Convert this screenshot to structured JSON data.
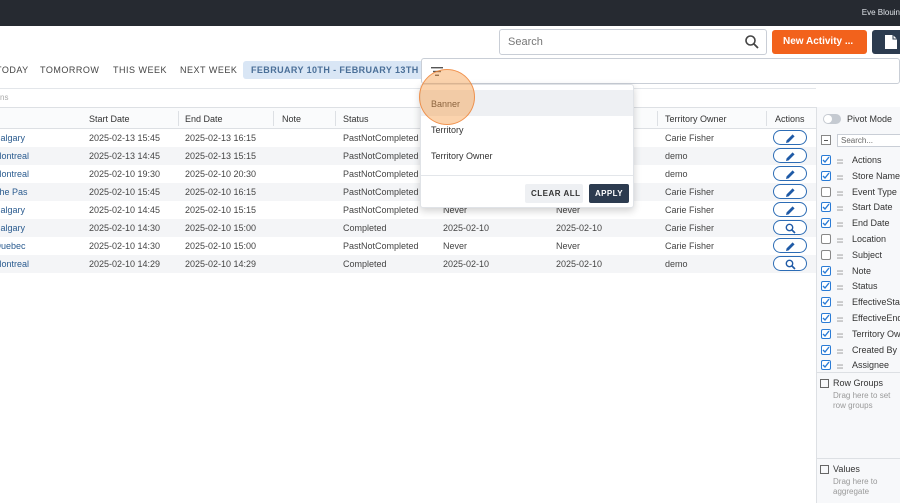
{
  "topbar": {
    "user": "Eve Blouin"
  },
  "toolbar": {
    "search_placeholder": "Search",
    "new_activity_label": "New Activity ..."
  },
  "quick_filters": {
    "today": "TODAY",
    "tomorrow": "TOMORROW",
    "this_week": "THIS WEEK",
    "next_week": "NEXT WEEK",
    "range": "FEBRUARY 10TH - FEBRUARY 13TH"
  },
  "hint": "ns",
  "grid": {
    "headers": {
      "start_date": "Start Date",
      "end_date": "End Date",
      "note": "Note",
      "status": "Status",
      "territory_owner": "Territory Owner",
      "actions": "Actions"
    },
    "rows": [
      {
        "store": "Calgary",
        "start": "2025-02-13 15:45",
        "end": "2025-02-13 16:15",
        "status": "PastNotCompleted",
        "eff_start": "",
        "eff_end": "",
        "owner": "Carie Fisher",
        "action": "edit"
      },
      {
        "store": "Montreal",
        "start": "2025-02-13 14:45",
        "end": "2025-02-13 15:15",
        "status": "PastNotCompleted",
        "eff_start": "",
        "eff_end": "",
        "owner": "demo",
        "action": "edit"
      },
      {
        "store": "Montreal",
        "start": "2025-02-10 19:30",
        "end": "2025-02-10 20:30",
        "status": "PastNotCompleted",
        "eff_start": "",
        "eff_end": "",
        "owner": "demo",
        "action": "edit"
      },
      {
        "store": "The Pas",
        "start": "2025-02-10 15:45",
        "end": "2025-02-10 16:15",
        "status": "PastNotCompleted",
        "eff_start": "",
        "eff_end": "",
        "owner": "Carie Fisher",
        "action": "edit"
      },
      {
        "store": "Calgary",
        "start": "2025-02-10 14:45",
        "end": "2025-02-10 15:15",
        "status": "PastNotCompleted",
        "eff_start": "Never",
        "eff_end": "Never",
        "owner": "Carie Fisher",
        "action": "edit"
      },
      {
        "store": "Calgary",
        "start": "2025-02-10 14:30",
        "end": "2025-02-10 15:00",
        "status": "Completed",
        "eff_start": "2025-02-10",
        "eff_end": "2025-02-10",
        "owner": "Carie Fisher",
        "action": "view"
      },
      {
        "store": "Quebec",
        "start": "2025-02-10 14:30",
        "end": "2025-02-10 15:00",
        "status": "PastNotCompleted",
        "eff_start": "Never",
        "eff_end": "Never",
        "owner": "Carie Fisher",
        "action": "edit"
      },
      {
        "store": "Montreal",
        "start": "2025-02-10 14:29",
        "end": "2025-02-10 14:29",
        "status": "Completed",
        "eff_start": "2025-02-10",
        "eff_end": "2025-02-10",
        "owner": "demo",
        "action": "view"
      }
    ]
  },
  "filter_dropdown": {
    "options": [
      "Banner",
      "Territory",
      "Territory Owner"
    ],
    "clear_label": "CLEAR ALL",
    "apply_label": "APPLY"
  },
  "side_panel": {
    "pivot_label": "Pivot Mode",
    "search_placeholder": "Search...",
    "columns": [
      {
        "label": "Actions",
        "checked": true
      },
      {
        "label": "Store Name",
        "checked": true
      },
      {
        "label": "Event Type",
        "checked": false
      },
      {
        "label": "Start Date",
        "checked": true
      },
      {
        "label": "End Date",
        "checked": true
      },
      {
        "label": "Location",
        "checked": false
      },
      {
        "label": "Subject",
        "checked": false
      },
      {
        "label": "Note",
        "checked": true
      },
      {
        "label": "Status",
        "checked": true
      },
      {
        "label": "EffectiveStart",
        "checked": true
      },
      {
        "label": "EffectiveEnd",
        "checked": true
      },
      {
        "label": "Territory Owner",
        "checked": true
      },
      {
        "label": "Created By",
        "checked": true
      },
      {
        "label": "Assignee",
        "checked": true
      }
    ],
    "row_groups_title": "Row Groups",
    "row_groups_hint": "Drag here to set row groups",
    "values_title": "Values",
    "values_hint": "Drag here to aggregate"
  },
  "colors": {
    "accent": "#f2621c",
    "dark": "#2c3b4f",
    "link": "#2a5b8f",
    "check": "#2a7bd5"
  }
}
